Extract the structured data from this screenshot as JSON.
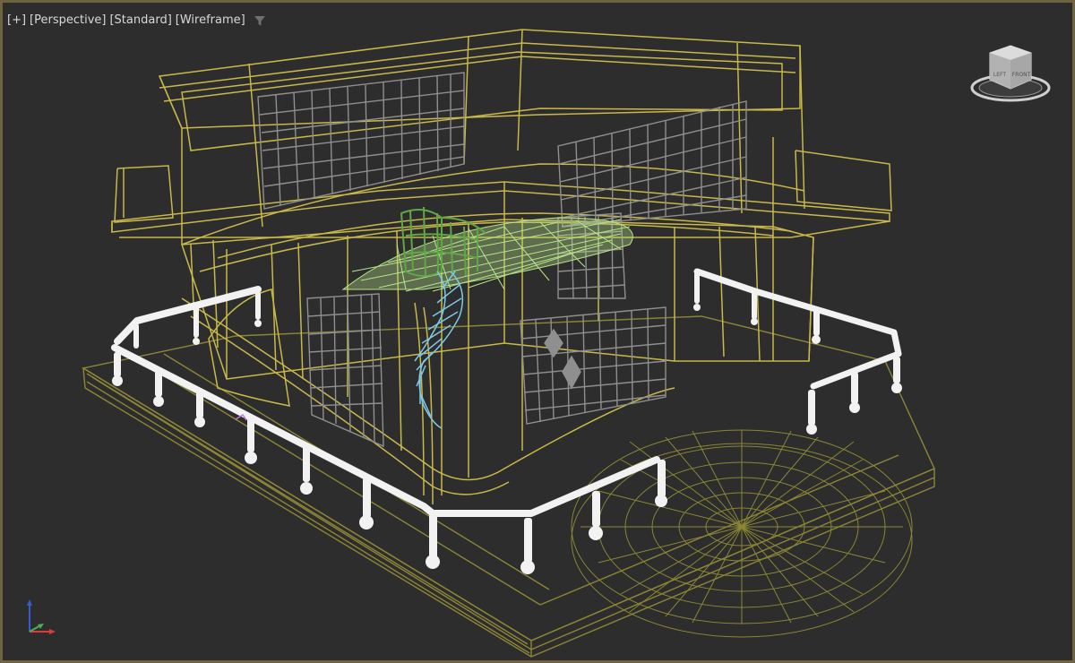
{
  "viewport": {
    "label_plus": "[+]",
    "label_view": "[Perspective]",
    "label_shading_preset": "[Standard]",
    "label_shading_mode": "[Wireframe]",
    "filter_icon": "funnel-filter-icon"
  },
  "viewcube": {
    "face_front": "FRONT",
    "face_left": "LEFT"
  },
  "axis_gizmo": {
    "x_color": "#e03a3a",
    "y_color": "#4caf50",
    "z_color": "#3a5bd0"
  },
  "colors": {
    "background": "#2d2d2d",
    "border": "#6e6440",
    "wire_yellow": "#c9b84a",
    "wire_gray": "#8f8f8f",
    "wire_white": "#f2f2f2",
    "wire_green": "#5fa845",
    "wire_cyan": "#7ec9e8",
    "wire_olive": "#8a8634"
  }
}
